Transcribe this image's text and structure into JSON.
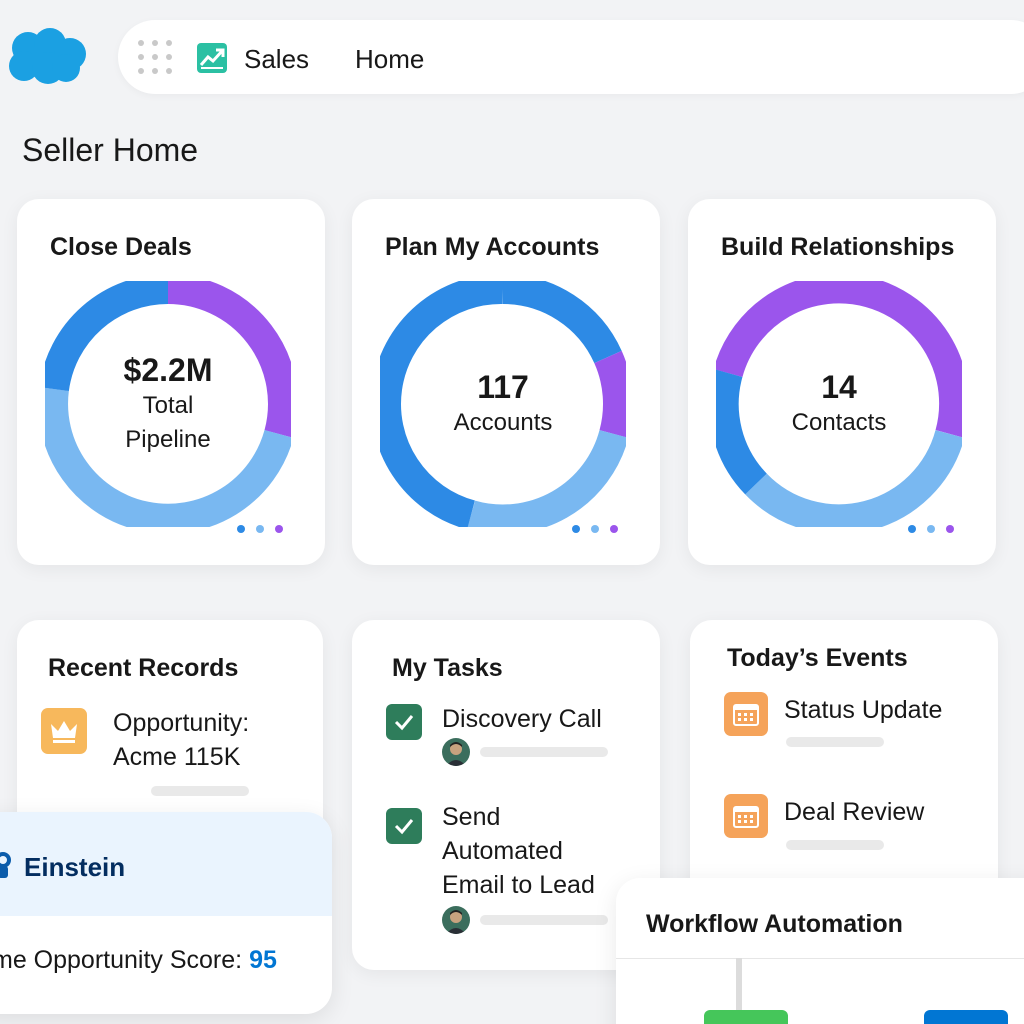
{
  "header": {
    "app_name": "Sales",
    "nav_home": "Home",
    "brand_color": "#1ba0e2",
    "icons": [
      "cloud-logo-icon",
      "app-launcher-icon",
      "sales-chart-icon"
    ]
  },
  "page": {
    "title": "Seller Home"
  },
  "colors": {
    "segment_blue": "#2d8ae5",
    "segment_light_blue": "#79b8f1",
    "segment_purple": "#9b55ec",
    "task_check": "#2e7d5b",
    "event_orange": "#f5a35a",
    "score_blue": "#0176d3"
  },
  "kpis": [
    {
      "title": "Close Deals",
      "value": "$2.2M",
      "label_line1": "Total",
      "label_line2": "Pipeline"
    },
    {
      "title": "Plan My Accounts",
      "value": "117",
      "label_line1": "Accounts",
      "label_line2": ""
    },
    {
      "title": "Build Relationships",
      "value": "14",
      "label_line1": "Contacts",
      "label_line2": ""
    }
  ],
  "recent_records": {
    "title": "Recent Records",
    "items": [
      {
        "line1": "Opportunity:",
        "line2": "Acme 115K",
        "icon": "crown-icon"
      }
    ]
  },
  "tasks": {
    "title": "My Tasks",
    "items": [
      {
        "line1": "Discovery Call",
        "line2": "",
        "line3": "",
        "done": true
      },
      {
        "line1": "Send",
        "line2": "Automated",
        "line3": "Email to Lead",
        "done": true
      }
    ]
  },
  "events": {
    "title": "Today’s Events",
    "items": [
      {
        "label": "Status Update",
        "icon": "calendar-icon"
      },
      {
        "label": "Deal Review",
        "icon": "calendar-icon"
      }
    ]
  },
  "einstein": {
    "title": "Einstein",
    "score_label": "me Opportunity Score: ",
    "score_value": "95"
  },
  "workflow": {
    "title": "Workflow Automation"
  }
}
